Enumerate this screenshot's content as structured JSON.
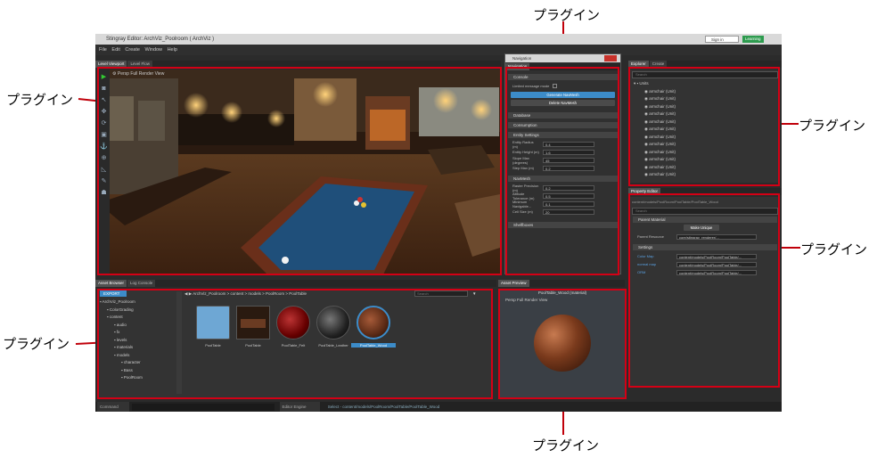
{
  "window": {
    "title": "Stingray Editor: ArchViz_Poolroom ( ArchViz )",
    "sign_in": "Sign in",
    "learning": "Learning"
  },
  "menu": [
    "File",
    "Edit",
    "Create",
    "Window",
    "Help"
  ],
  "viewport": {
    "tabs": [
      "Level Viewport",
      "Level Flow"
    ],
    "toolbar": [
      "Persp",
      "Full Render",
      "View"
    ]
  },
  "navigation": {
    "window_title": "Navigation",
    "tab": "Navigation",
    "sections": {
      "console": "Console",
      "database": "Database",
      "consumption": "Consumption",
      "entity_settings": "Entity Settings",
      "navmesh": "NavMesh",
      "shelfboxes": "Shelfboxes"
    },
    "limited_message_mode": "Limited message mode",
    "generate_button": "Generate NavMesh",
    "delete_button": "Delete NavMesh",
    "entity_rows": [
      {
        "label": "Entity Radius (m)",
        "value": "0.4"
      },
      {
        "label": "Entity Height (m)",
        "value": "1.6"
      },
      {
        "label": "Slope Max (degrees)",
        "value": "45"
      },
      {
        "label": "Step Max (m)",
        "value": "0.2"
      }
    ],
    "navmesh_rows": [
      {
        "label": "Raster Precision (m)",
        "value": "0.2"
      },
      {
        "label": "Altitude Tolerance (m)",
        "value": "0.5"
      },
      {
        "label": "Minimum Navigable...",
        "value": "0.1"
      },
      {
        "label": "Cell Size (m)",
        "value": "20"
      }
    ]
  },
  "explorer": {
    "tabs": [
      "Explorer",
      "Create"
    ],
    "search_placeholder": "Search",
    "root": "Units",
    "items": [
      "armchair (Unit)",
      "armchair (Unit)",
      "armchair (Unit)",
      "armchair (Unit)",
      "armchair (Unit)",
      "armchair (Unit)",
      "armchair (Unit)",
      "armchair (Unit)",
      "armchair (Unit)",
      "armchair (Unit)",
      "armchair (Unit)",
      "armchair (Unit)",
      "armchair (Unit)"
    ]
  },
  "property_editor": {
    "tab": "Property Editor",
    "path": "content/models/PoolRoom/PoolTable/PoolTable_Wood",
    "search_placeholder": "Search",
    "parent_material_header": "Parent Material",
    "make_unique": "Make Unique",
    "parent_label": "Parent Resource",
    "parent_value": "core/stingray_renderer/...",
    "settings_header": "Settings",
    "settings": [
      {
        "label": "Color Map",
        "value": "content/models/PoolRoom/PoolTable/..."
      },
      {
        "label": "normal map",
        "value": "content/models/PoolRoom/PoolTable/..."
      },
      {
        "label": "ORM",
        "value": "content/models/PoolRoom/PoolTable/..."
      }
    ]
  },
  "asset_browser": {
    "tabs": [
      "Asset Browser",
      "Log Console"
    ],
    "export": "EXPORT",
    "breadcrumb": "ArchViz_Poolroom > content > models > PoolRoom > PoolTable",
    "search_placeholder": "Search",
    "folders": [
      {
        "name": "ArchViz_Poolroom",
        "depth": 0
      },
      {
        "name": "ColorGrading",
        "depth": 1
      },
      {
        "name": "content",
        "depth": 1
      },
      {
        "name": "audio",
        "depth": 2
      },
      {
        "name": "fx",
        "depth": 2
      },
      {
        "name": "levels",
        "depth": 2
      },
      {
        "name": "materials",
        "depth": 2
      },
      {
        "name": "models",
        "depth": 2
      },
      {
        "name": "character",
        "depth": 3
      },
      {
        "name": "Bass",
        "depth": 3
      },
      {
        "name": "PoolRoom",
        "depth": 3
      }
    ],
    "assets": [
      "PoolTable",
      "PoolTable",
      "PoolTable_Felt",
      "PoolTable_Leather",
      "PoolTable_Wood"
    ]
  },
  "asset_preview": {
    "tab": "Asset Preview",
    "title": "PoolTable_Wood (material)",
    "toolbar": [
      "Persp",
      "Full Render",
      "View"
    ]
  },
  "status": {
    "command": "Command",
    "engine": "Editor Engine",
    "message": "Select - content/models/PoolRoom/PoolTable/PoolTable_Wood"
  },
  "callouts": {
    "viewport": "プラグイン",
    "navigation": "プラグイン",
    "explorer": "プラグイン",
    "property_editor": "プラグイン",
    "asset_browser": "プラグイン",
    "asset_preview": "プラグイン"
  },
  "colors": {
    "highlight": "#d40015",
    "accent_blue": "#3c8cc9",
    "panel": "#333333"
  }
}
